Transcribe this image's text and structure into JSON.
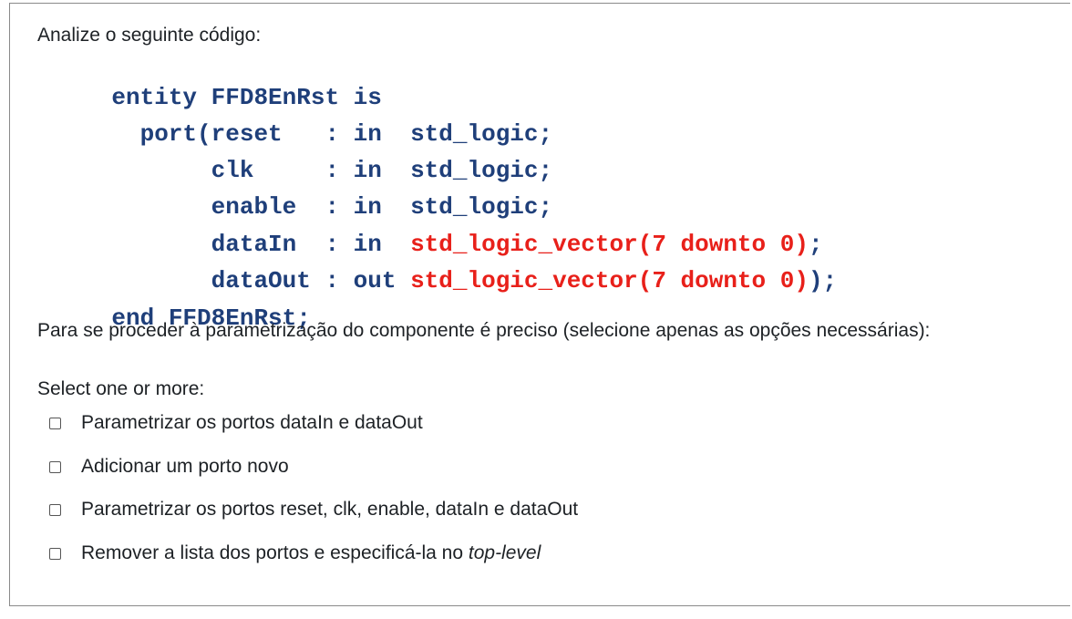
{
  "question": {
    "intro": "Analize o seguinte código:",
    "code_lines": [
      {
        "parts": [
          {
            "text": "entity FFD8EnRst is",
            "color": "#1f3f7a"
          }
        ]
      },
      {
        "parts": [
          {
            "text": "  port(reset   : in  std_logic;",
            "color": "#1f3f7a"
          }
        ]
      },
      {
        "parts": [
          {
            "text": "       clk     : in  std_logic;",
            "color": "#1f3f7a"
          }
        ]
      },
      {
        "parts": [
          {
            "text": "       enable  : in  std_logic;",
            "color": "#1f3f7a"
          }
        ]
      },
      {
        "parts": [
          {
            "text": "       dataIn  : in  ",
            "color": "#1f3f7a"
          },
          {
            "text": "std_logic_vector(7 downto 0)",
            "color": "#e8201a"
          },
          {
            "text": ";",
            "color": "#1f3f7a"
          }
        ]
      },
      {
        "parts": [
          {
            "text": "       dataOut : out ",
            "color": "#1f3f7a"
          },
          {
            "text": "std_logic_vector(7 downto 0)",
            "color": "#e8201a"
          },
          {
            "text": ");",
            "color": "#1f3f7a"
          }
        ]
      },
      {
        "parts": [
          {
            "text": "end FFD8EnRst;",
            "color": "#1f3f7a"
          }
        ]
      }
    ],
    "text": "Para se proceder à parametrização do componente é preciso (selecione apenas as opções necessárias):",
    "prompt": "Select one or more:",
    "options": [
      {
        "label": "Parametrizar os portos dataIn e dataOut",
        "checked": false
      },
      {
        "label": "Adicionar um porto novo",
        "checked": false
      },
      {
        "label": "Parametrizar os portos reset, clk, enable, dataIn e dataOut",
        "checked": false
      },
      {
        "label_prefix": "Remover a lista dos portos e especificá-la no ",
        "label_italic": "top-level",
        "checked": false
      }
    ]
  }
}
